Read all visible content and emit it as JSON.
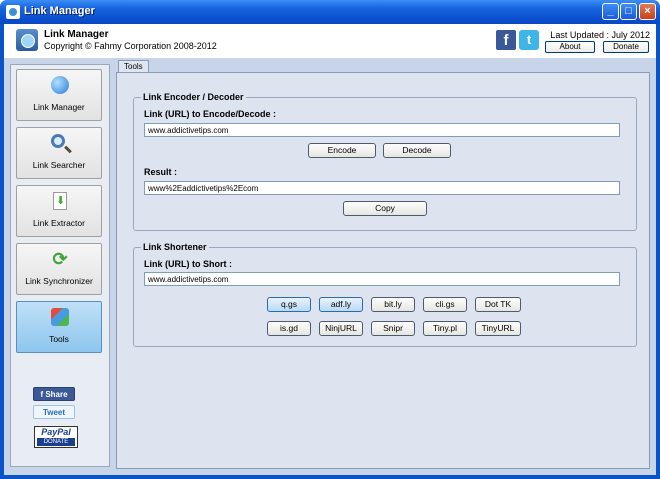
{
  "window": {
    "title": "Link Manager"
  },
  "header": {
    "app_name": "Link Manager",
    "copyright": "Copyright © Fahmy Corporation 2008-2012",
    "last_updated": "Last Updated : July 2012",
    "about_label": "About",
    "donate_label": "Donate"
  },
  "sidebar": {
    "items": [
      {
        "label": "Link Manager"
      },
      {
        "label": "Link Searcher"
      },
      {
        "label": "Link Extractor"
      },
      {
        "label": "Link Synchronizer"
      },
      {
        "label": "Tools"
      }
    ],
    "share_label": "f  Share",
    "tweet_label": "Tweet",
    "paypal_label": "PayPal",
    "paypal_donate_label": "DONATE"
  },
  "main": {
    "tab_label": "Tools",
    "encoder": {
      "title": "Link Encoder / Decoder",
      "input_label": "Link (URL) to Encode/Decode :",
      "input_value": "www.addictivetips.com",
      "encode_label": "Encode",
      "decode_label": "Decode",
      "result_label": "Result :",
      "result_value": "www%2Eaddictivetips%2Ecom",
      "copy_label": "Copy"
    },
    "shortener": {
      "title": "Link Shortener",
      "input_label": "Link (URL) to Short :",
      "input_value": "www.addictivetips.com",
      "services": [
        "q.gs",
        "adf.ly",
        "bit.ly",
        "cli.gs",
        "Dot TK",
        "is.gd",
        "NinjURL",
        "Snipr",
        "Tiny.pl",
        "TinyURL"
      ]
    }
  },
  "colors": {
    "titlebar": "#0b4fce",
    "panel_bg": "#dde4f0",
    "active_nav": "#8ec6ee"
  }
}
